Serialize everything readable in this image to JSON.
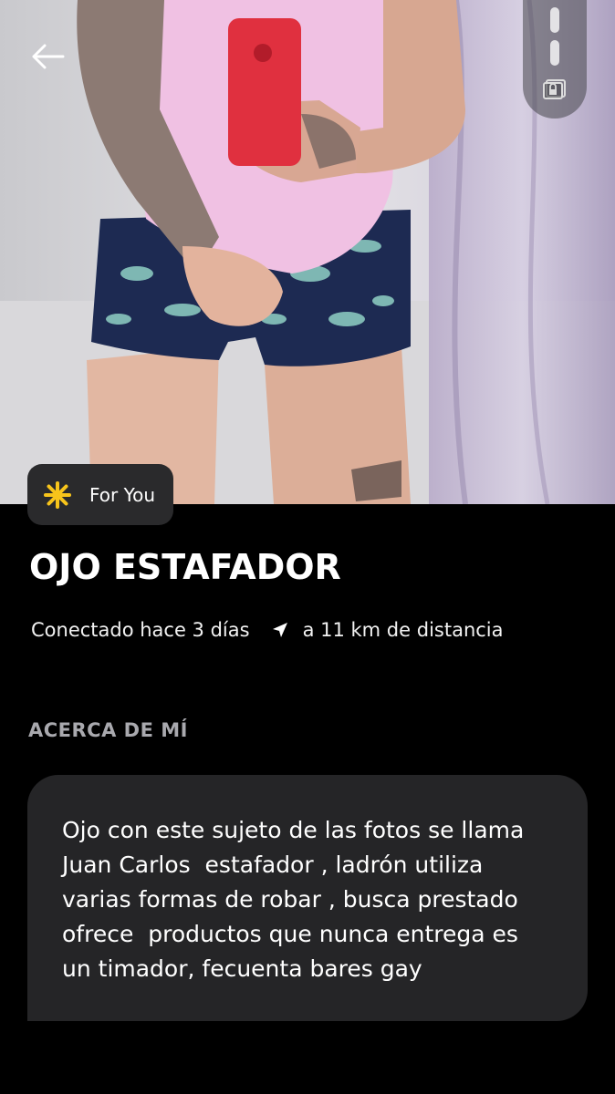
{
  "profile": {
    "name": "OJO ESTAFADOR",
    "badge_label": "For You",
    "last_seen": "Conectado hace 3 días",
    "distance": "a 11 km de distancia"
  },
  "about": {
    "title": "ACERCA DE MÍ",
    "text": "Ojo con este sujeto de las fotos se llama\nJuan Carlos  estafador , ladrón utiliza\nvarias formas de robar , busca prestado\nofrece  productos que nunca entrega es\nun timador, fecuenta bares gay"
  },
  "icons": {
    "back": "arrow-left-icon",
    "lock": "private-photo-lock-icon",
    "star": "asterisk-star-icon",
    "navigation": "navigation-arrow-icon"
  },
  "colors": {
    "background": "#000000",
    "card": "#252527",
    "badge": "#2a2a2c",
    "accent_yellow": "#f7c41b",
    "muted_text": "#a9a9ae"
  }
}
